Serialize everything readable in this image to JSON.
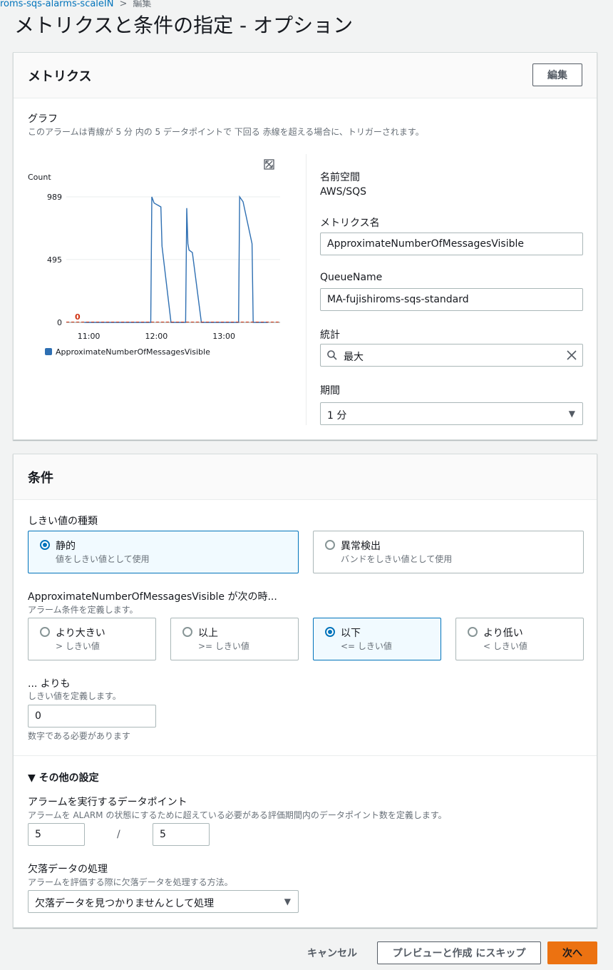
{
  "breadcrumb": {
    "parent": "roms-sqs-alarms-scaleIN",
    "sep": ">",
    "current": "編集"
  },
  "page_title": "メトリクスと条件の指定 - オプション",
  "metrics": {
    "title": "メトリクス",
    "edit_label": "編集",
    "graph_label": "グラフ",
    "graph_desc": "このアラームは青線が 5 分 内の 5 データポイントで 下回る 赤線を超える場合に、トリガーされます。",
    "namespace_label": "名前空間",
    "namespace_value": "AWS/SQS",
    "metric_name_label": "メトリクス名",
    "metric_name_value": "ApproximateNumberOfMessagesVisible",
    "queue_label": "QueueName",
    "queue_value": "MA-fujishiroms-sqs-standard",
    "stat_label": "統計",
    "stat_value": "最大",
    "period_label": "期間",
    "period_value": "1 分"
  },
  "chart_data": {
    "type": "line",
    "ylabel": "Count",
    "yticks": [
      "989",
      "495",
      "0"
    ],
    "ylim": [
      0,
      989
    ],
    "xticks": [
      "11:00",
      "12:00",
      "13:00"
    ],
    "threshold_label": "0",
    "legend": "ApproximateNumberOfMessagesVisible",
    "colors": {
      "series": "#2e6fb2",
      "threshold": "#d13212"
    },
    "x": [
      "10:56",
      "11:55",
      "11:56",
      "11:58",
      "12:04",
      "12:05",
      "12:13",
      "12:14",
      "12:26",
      "12:27",
      "12:28",
      "12:29",
      "12:32",
      "12:40",
      "12:41",
      "13:13",
      "13:14",
      "13:17",
      "13:25",
      "13:26",
      "13:39"
    ],
    "values": [
      0,
      0,
      989,
      940,
      910,
      600,
      0,
      0,
      0,
      900,
      620,
      570,
      550,
      0,
      0,
      0,
      989,
      950,
      620,
      0,
      0
    ],
    "threshold": 0
  },
  "conditions": {
    "title": "条件",
    "threshold_type_label": "しきい値の種類",
    "static_title": "静的",
    "static_desc": "値をしきい値として使用",
    "anomaly_title": "異常検出",
    "anomaly_desc": "バンドをしきい値として使用",
    "when_label": "ApproximateNumberOfMessagesVisible が次の時...",
    "when_desc": "アラーム条件を定義します。",
    "opts": [
      {
        "title": "より大きい",
        "desc": "> しきい値"
      },
      {
        "title": "以上",
        "desc": ">= しきい値"
      },
      {
        "title": "以下",
        "desc": "<= しきい値"
      },
      {
        "title": "より低い",
        "desc": "< しきい値"
      }
    ],
    "than_label": "... よりも",
    "than_desc": "しきい値を定義します。",
    "than_value": "0",
    "than_help": "数字である必要があります",
    "other_settings": "▼ その他の設定",
    "dp_label": "アラームを実行するデータポイント",
    "dp_desc": "アラームを ALARM の状態にするために超えている必要がある評価期間内のデータポイント数を定義します。",
    "dp_value1": "5",
    "dp_slash": "/",
    "dp_value2": "5",
    "missing_label": "欠落データの処理",
    "missing_desc": "アラームを評価する際に欠落データを処理する方法。",
    "missing_value": "欠落データを見つかりませんとして処理"
  },
  "footer": {
    "cancel": "キャンセル",
    "skip": "プレビューと作成 にスキップ",
    "next": "次へ"
  }
}
